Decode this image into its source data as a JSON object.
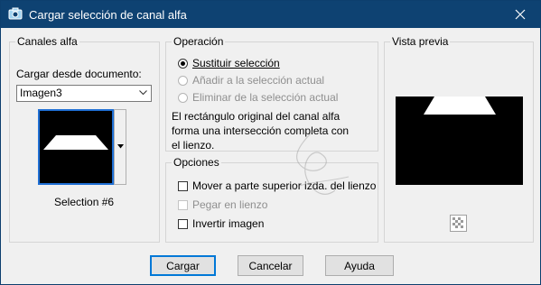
{
  "window": {
    "title": "Cargar selección de canal alfa"
  },
  "canales": {
    "group_label": "Canales alfa",
    "load_label": "Cargar desde documento:",
    "document_value": "Imagen3",
    "selection_caption": "Selection #6"
  },
  "operacion": {
    "group_label": "Operación",
    "options": [
      {
        "label": "Sustituir selección",
        "selected": true,
        "enabled": true
      },
      {
        "label": "Añadir a la selección actual",
        "selected": false,
        "enabled": false
      },
      {
        "label": "Eliminar de la selección actual",
        "selected": false,
        "enabled": false
      }
    ],
    "description": "El rectángulo original del canal alfa forma una intersección completa con el lienzo."
  },
  "opciones": {
    "group_label": "Opciones",
    "checks": [
      {
        "label": "Mover a parte superior izda. del lienzo",
        "checked": false,
        "enabled": true
      },
      {
        "label": "Pegar en lienzo",
        "checked": false,
        "enabled": false
      },
      {
        "label": "Invertir imagen",
        "checked": false,
        "enabled": true
      }
    ]
  },
  "vista": {
    "group_label": "Vista previa"
  },
  "buttons": {
    "load": "Cargar",
    "cancel": "Cancelar",
    "help": "Ayuda"
  },
  "colors": {
    "titlebar": "#0e4272",
    "accent": "#0078d7"
  }
}
